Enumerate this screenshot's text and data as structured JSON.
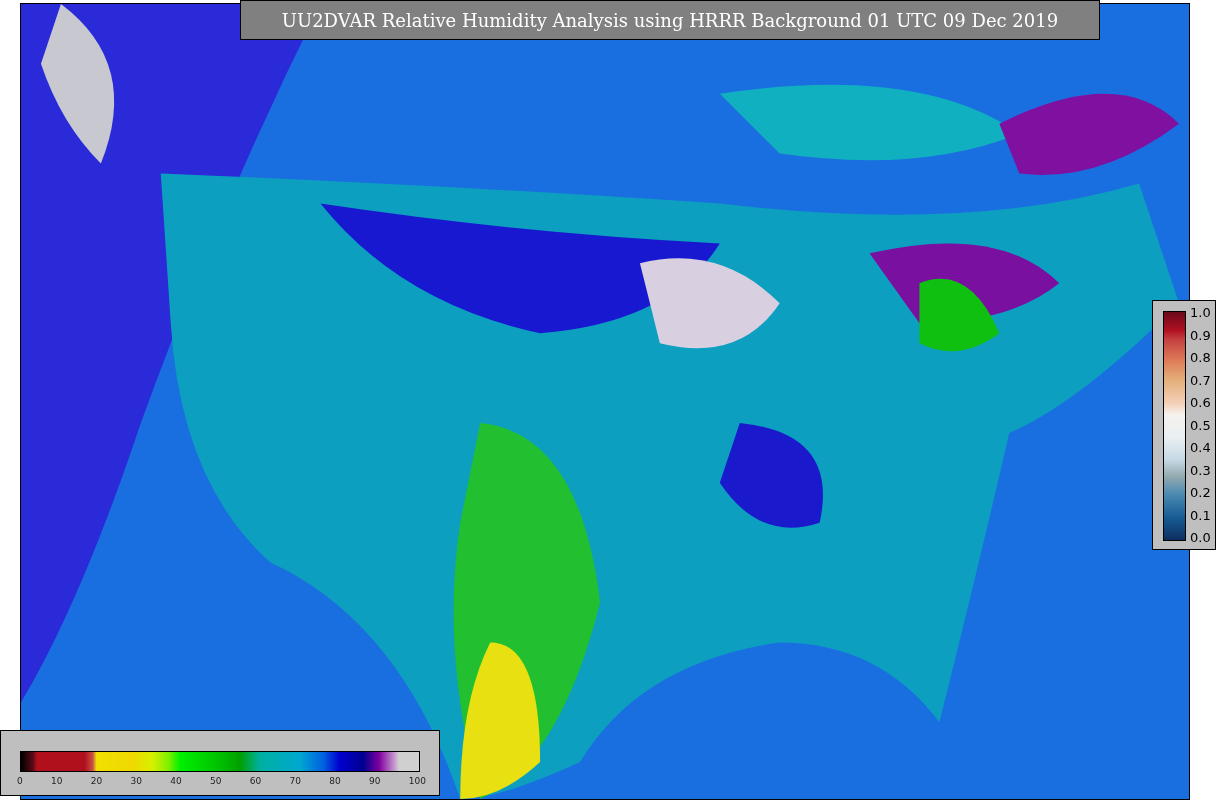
{
  "title": "UU2DVAR Relative Humidity Analysis using HRRR Background 01 UTC 09 Dec 2019",
  "station_colorbar": {
    "ticks": [
      "1.0",
      "0.9",
      "0.8",
      "0.7",
      "0.6",
      "0.5",
      "0.4",
      "0.3",
      "0.2",
      "0.1",
      "0.0"
    ]
  },
  "humidity_colorbar": {
    "ticks": [
      "0",
      "10",
      "20",
      "30",
      "40",
      "50",
      "60",
      "70",
      "80",
      "90",
      "100"
    ]
  }
}
